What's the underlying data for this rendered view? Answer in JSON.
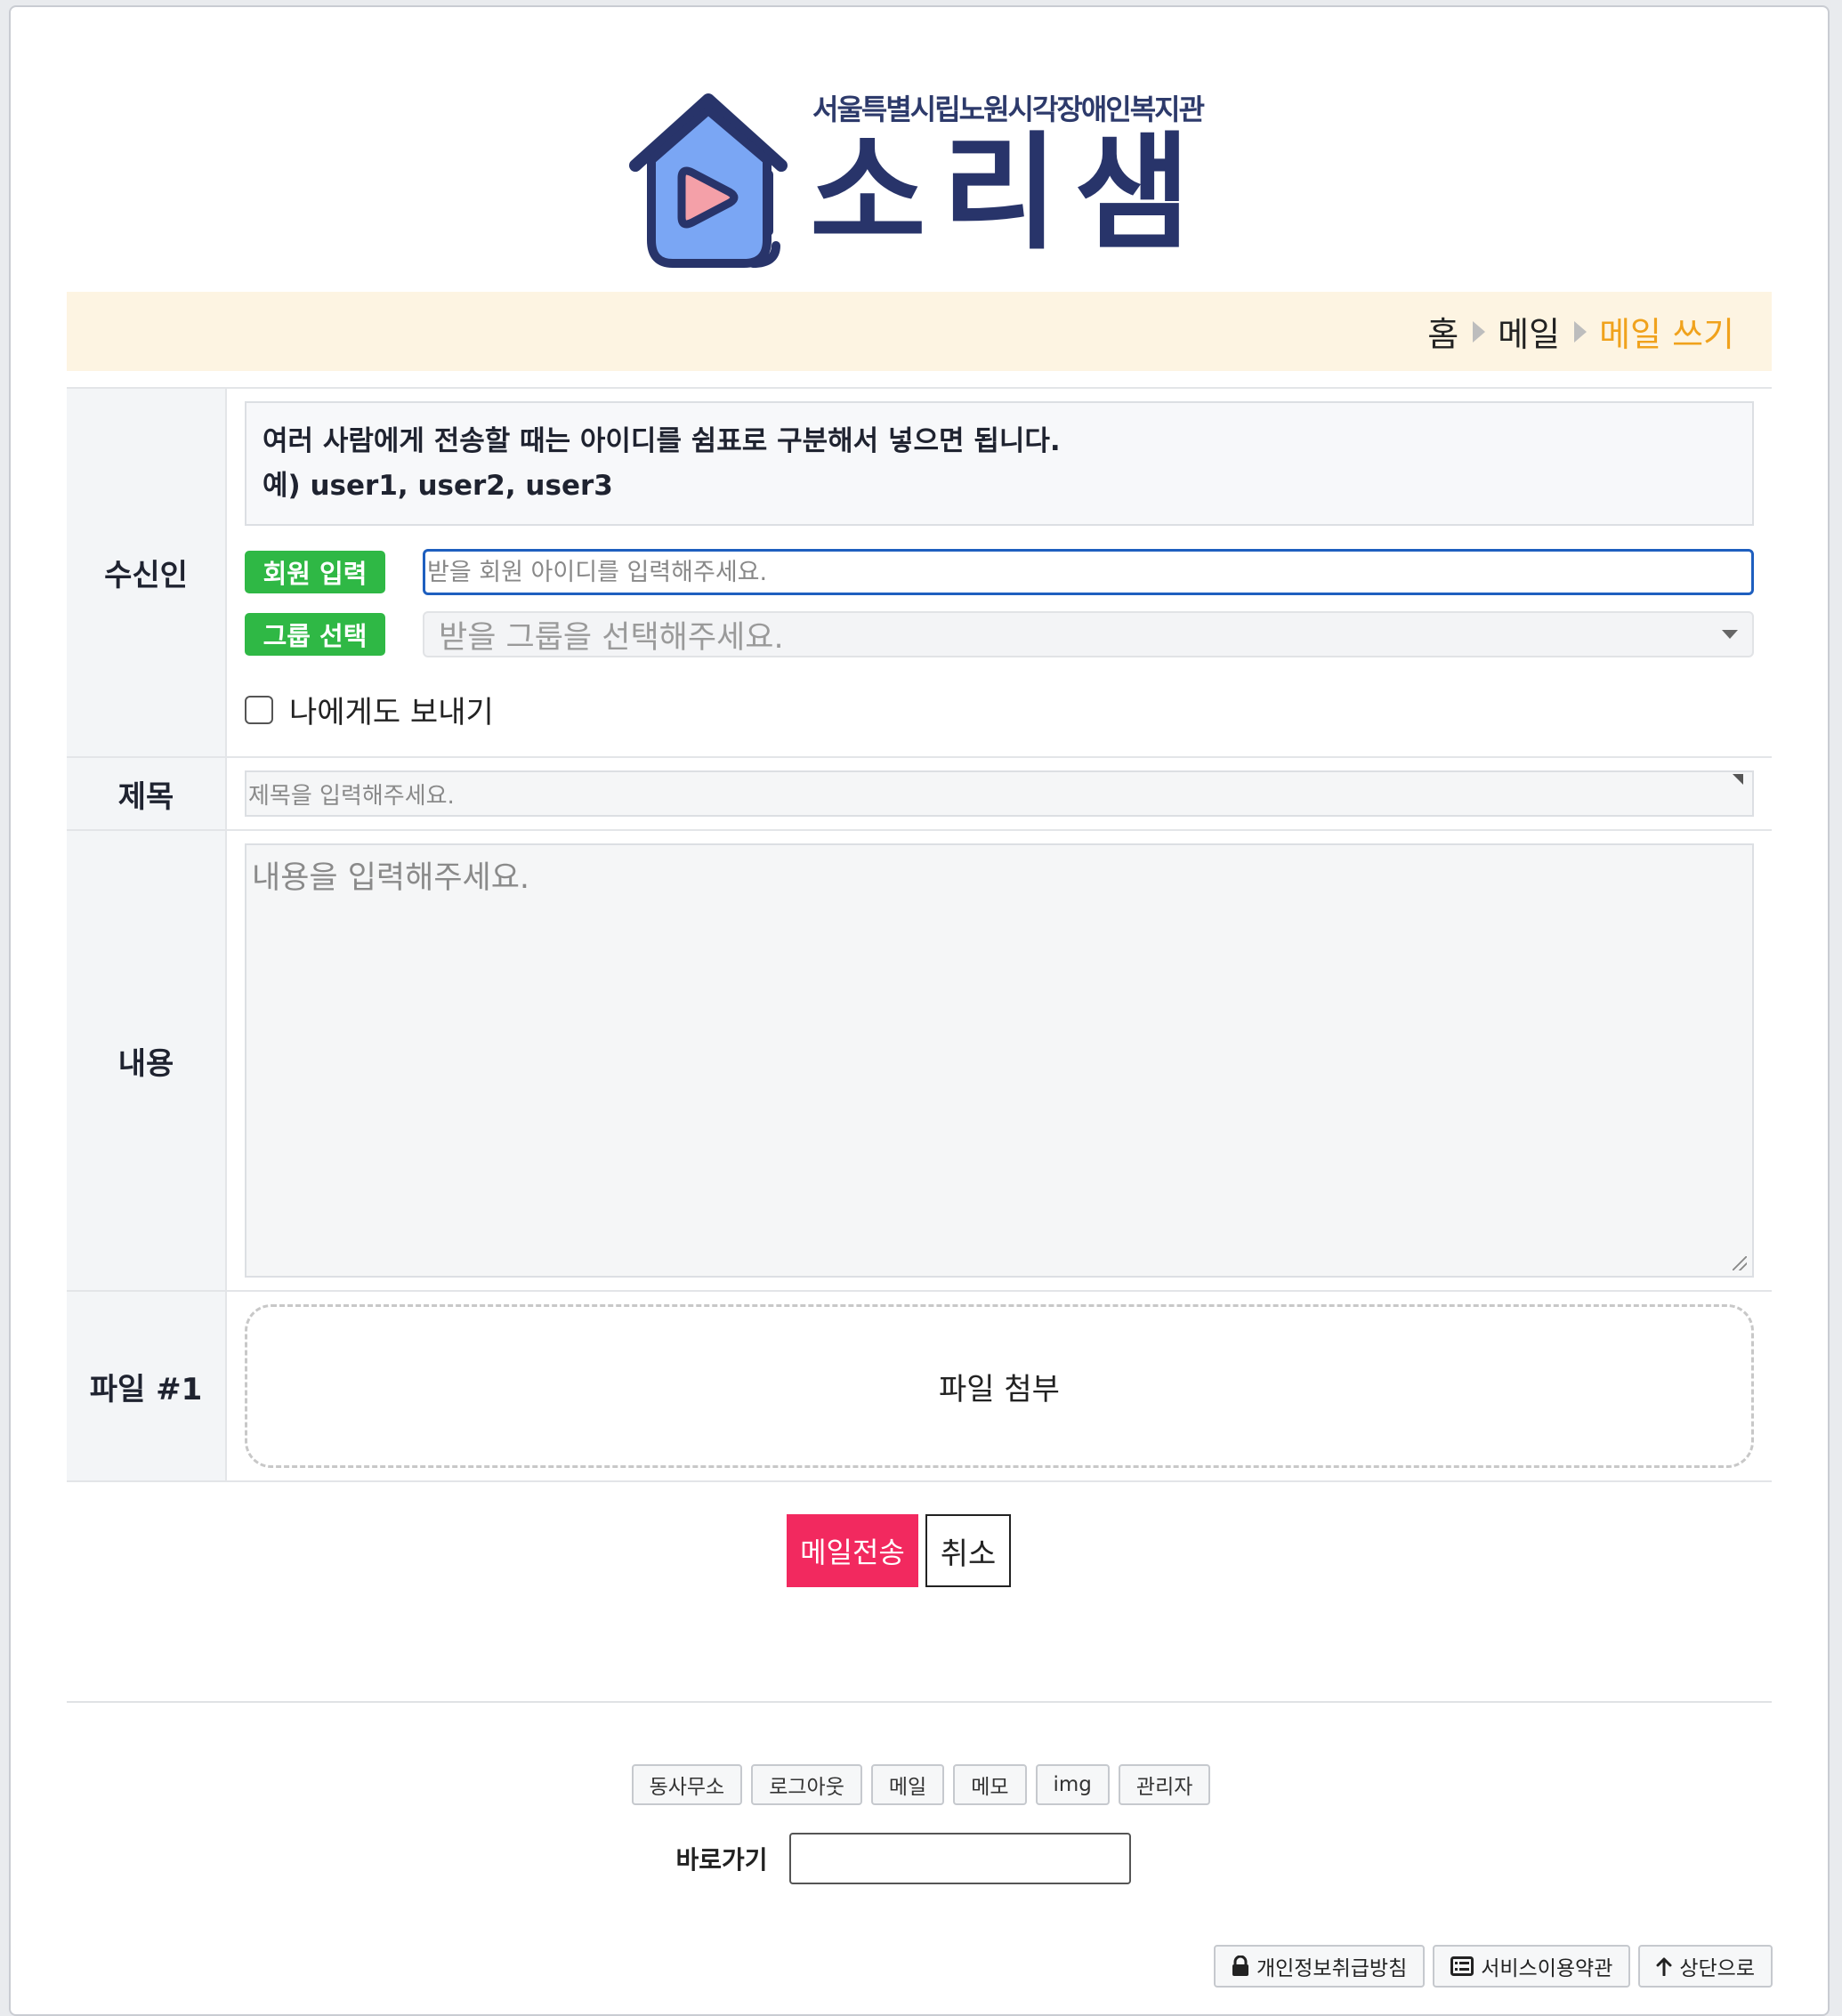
{
  "logo": {
    "subtitle": "서울특별시립노원시각장애인복지관",
    "title": "소리샘"
  },
  "breadcrumb": {
    "items": [
      "홈",
      "메일",
      "메일 쓰기"
    ]
  },
  "form": {
    "recipient": {
      "label": "수신인",
      "notice_line1": "여러 사람에게 전송할 때는 아이디를 쉼표로 구분해서 넣으면 됩니다.",
      "notice_line2": "예) user1, user2, user3",
      "member_button": "회원 입력",
      "member_placeholder": "받을 회원 아이디를 입력해주세요.",
      "group_button": "그룹 선택",
      "group_placeholder": "받을 그룹을 선택해주세요.",
      "send_to_self": "나에게도 보내기"
    },
    "subject": {
      "label": "제목",
      "placeholder": "제목을 입력해주세요."
    },
    "content": {
      "label": "내용",
      "placeholder": "내용을 입력해주세요."
    },
    "file": {
      "label": "파일 #1",
      "drop_text": "파일 첨부"
    }
  },
  "actions": {
    "send": "메일전송",
    "cancel": "취소"
  },
  "footer": {
    "links": [
      "동사무소",
      "로그아웃",
      "메일",
      "메모",
      "img",
      "관리자"
    ],
    "goto_label": "바로가기",
    "bottom": {
      "privacy": "개인정보취급방침",
      "terms": "서비스이용약관",
      "top": "상단으로"
    }
  },
  "colors": {
    "brand_navy": "#28346a",
    "logo_blue": "#7aa6f4",
    "logo_pink": "#f4a0a8",
    "breadcrumb_bg": "#fdf4e2",
    "breadcrumb_active": "#f0a21c",
    "green_button": "#2fb845",
    "send_button": "#f2295f",
    "focus_border": "#1e5fbf"
  }
}
